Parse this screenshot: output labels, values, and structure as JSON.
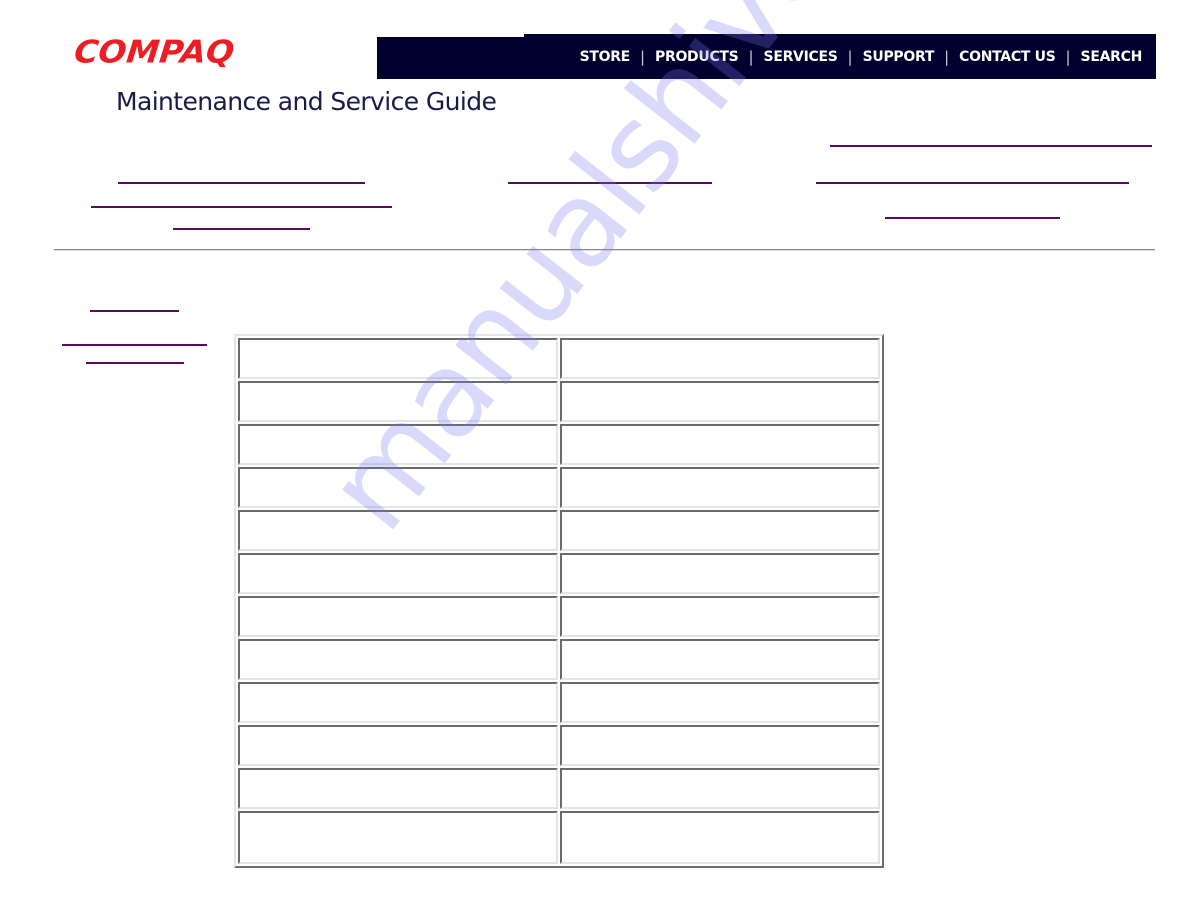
{
  "header": {
    "logo_text": "COMPAQ",
    "brand_color": "#ee1c23",
    "nav_background": "#00002e",
    "nav_items": [
      "STORE",
      "PRODUCTS",
      "SERVICES",
      "SUPPORT",
      "CONTACT US",
      "SEARCH"
    ],
    "nav_separator": "|",
    "title": "Maintenance and Service Guide"
  },
  "links": {
    "color": "#5a0a5a",
    "top_links": [
      "",
      "",
      "",
      "",
      "",
      "",
      "",
      ""
    ],
    "side_links": [
      "",
      "",
      ""
    ]
  },
  "table": {
    "rows": [
      [
        "",
        ""
      ],
      [
        "",
        ""
      ],
      [
        "",
        ""
      ],
      [
        "",
        ""
      ],
      [
        "",
        ""
      ],
      [
        "",
        ""
      ],
      [
        "",
        ""
      ],
      [
        "",
        ""
      ],
      [
        "",
        ""
      ],
      [
        "",
        ""
      ],
      [
        "",
        ""
      ],
      [
        "",
        ""
      ]
    ]
  },
  "watermark": "manualshive.com"
}
